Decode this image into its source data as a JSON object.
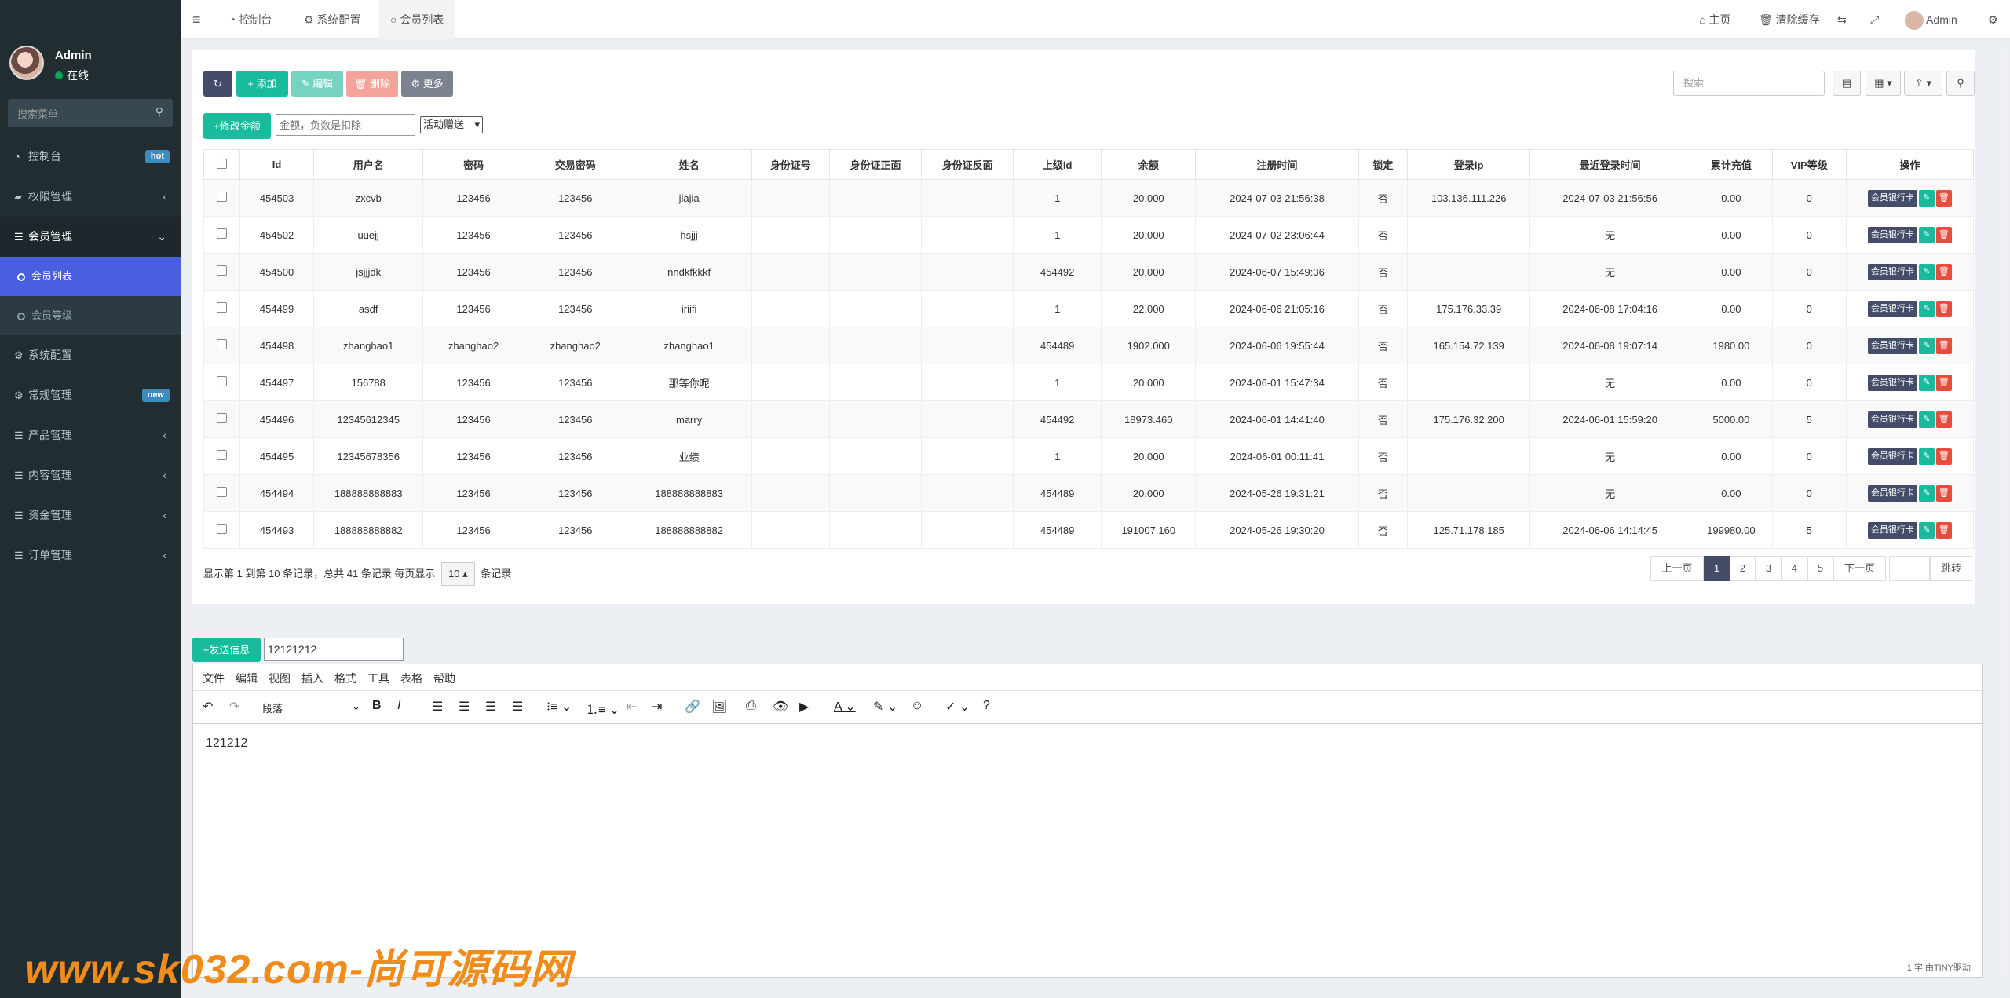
{
  "user": {
    "name": "Admin",
    "status": "在线"
  },
  "sidebar": {
    "search_placeholder": "搜索菜单",
    "items": [
      {
        "label": "控制台",
        "icon": "dashboard-icon",
        "badge": "hot",
        "badge_color": "#3c8dbc"
      },
      {
        "label": "权限管理",
        "icon": "group-icon",
        "arrow": "‹"
      },
      {
        "label": "会员管理",
        "icon": "list-icon",
        "arrow": "⌄"
      },
      {
        "label": "系统配置",
        "icon": "gear-icon"
      },
      {
        "label": "常规管理",
        "icon": "cogs-icon",
        "badge": "new",
        "badge_color": "#3c8dbc"
      },
      {
        "label": "产品管理",
        "icon": "list-icon",
        "arrow": "‹"
      },
      {
        "label": "内容管理",
        "icon": "list-icon",
        "arrow": "‹"
      },
      {
        "label": "资金管理",
        "icon": "list-icon",
        "arrow": "‹"
      },
      {
        "label": "订单管理",
        "icon": "list-icon",
        "arrow": "‹"
      }
    ],
    "subitems": [
      "会员列表",
      "会员等级"
    ]
  },
  "topbar": {
    "tabs": [
      "控制台",
      "系统配置",
      "会员列表"
    ],
    "home": "主页",
    "clear_cache": "清除缓存",
    "admin": "Admin"
  },
  "toolbar": {
    "add": "添加",
    "edit": "编辑",
    "delete": "删除",
    "more": "更多",
    "modify_amount": "修改金额",
    "amount_placeholder": "金额，负数是扣除",
    "select": "活动赠送",
    "search_placeholder": "搜索"
  },
  "table": {
    "headers": [
      "Id",
      "用户名",
      "密码",
      "交易密码",
      "姓名",
      "身份证号",
      "身份证正面",
      "身份证反面",
      "上级id",
      "余额",
      "注册时间",
      "锁定",
      "登录ip",
      "最近登录时间",
      "累计充值",
      "VIP等级",
      "操作"
    ],
    "rows": [
      [
        "454503",
        "zxcvb",
        "123456",
        "123456",
        "jiajia",
        "",
        "",
        "",
        "1",
        "20.000",
        "2024-07-03 21:56:38",
        "否",
        "103.136.111.226",
        "2024-07-03 21:56:56",
        "0.00",
        "0"
      ],
      [
        "454502",
        "uuejj",
        "123456",
        "123456",
        "hsjjj",
        "",
        "",
        "",
        "1",
        "20.000",
        "2024-07-02 23:06:44",
        "否",
        "",
        "无",
        "0.00",
        "0"
      ],
      [
        "454500",
        "jsjjjdk",
        "123456",
        "123456",
        "nndkfkkkf",
        "",
        "",
        "",
        "454492",
        "20.000",
        "2024-06-07 15:49:36",
        "否",
        "",
        "无",
        "0.00",
        "0"
      ],
      [
        "454499",
        "asdf",
        "123456",
        "123456",
        "iriifi",
        "",
        "",
        "",
        "1",
        "22.000",
        "2024-06-06 21:05:16",
        "否",
        "175.176.33.39",
        "2024-06-08 17:04:16",
        "0.00",
        "0"
      ],
      [
        "454498",
        "zhanghao1",
        "zhanghao2",
        "zhanghao2",
        "zhanghao1",
        "",
        "",
        "",
        "454489",
        "1902.000",
        "2024-06-06 19:55:44",
        "否",
        "165.154.72.139",
        "2024-06-08 19:07:14",
        "1980.00",
        "0"
      ],
      [
        "454497",
        "156788",
        "123456",
        "123456",
        "那等你呢",
        "",
        "",
        "",
        "1",
        "20.000",
        "2024-06-01 15:47:34",
        "否",
        "",
        "无",
        "0.00",
        "0"
      ],
      [
        "454496",
        "12345612345",
        "123456",
        "123456",
        "marry",
        "",
        "",
        "",
        "454492",
        "18973.460",
        "2024-06-01 14:41:40",
        "否",
        "175.176.32.200",
        "2024-06-01 15:59:20",
        "5000.00",
        "5"
      ],
      [
        "454495",
        "12345678356",
        "123456",
        "123456",
        "业绩",
        "",
        "",
        "",
        "1",
        "20.000",
        "2024-06-01 00:11:41",
        "否",
        "",
        "无",
        "0.00",
        "0"
      ],
      [
        "454494",
        "188888888883",
        "123456",
        "123456",
        "188888888883",
        "",
        "",
        "",
        "454489",
        "20.000",
        "2024-05-26 19:31:21",
        "否",
        "",
        "无",
        "0.00",
        "0"
      ],
      [
        "454493",
        "188888888882",
        "123456",
        "123456",
        "188888888882",
        "",
        "",
        "",
        "454489",
        "191007.160",
        "2024-05-26 19:30:20",
        "否",
        "125.71.178.185",
        "2024-06-06 14:14:45",
        "199980.00",
        "5"
      ]
    ],
    "bank_btn": "会员银行卡"
  },
  "pagination": {
    "summary": "显示第 1 到第 10 条记录，总共 41 条记录 每页显示",
    "per_page": "10",
    "suffix": "条记录",
    "prev": "上一页",
    "pages": [
      "1",
      "2",
      "3",
      "4",
      "5"
    ],
    "next": "下一页",
    "jump": "跳转"
  },
  "message": {
    "send": "发送信息",
    "value": "12121212"
  },
  "editor": {
    "menus": [
      "文件",
      "编辑",
      "视图",
      "插入",
      "格式",
      "工具",
      "表格",
      "帮助"
    ],
    "format": "段落",
    "body": "121212",
    "status": "1 字 由TINY驱动"
  },
  "watermark": "www.sk032.com-尚可源码网"
}
